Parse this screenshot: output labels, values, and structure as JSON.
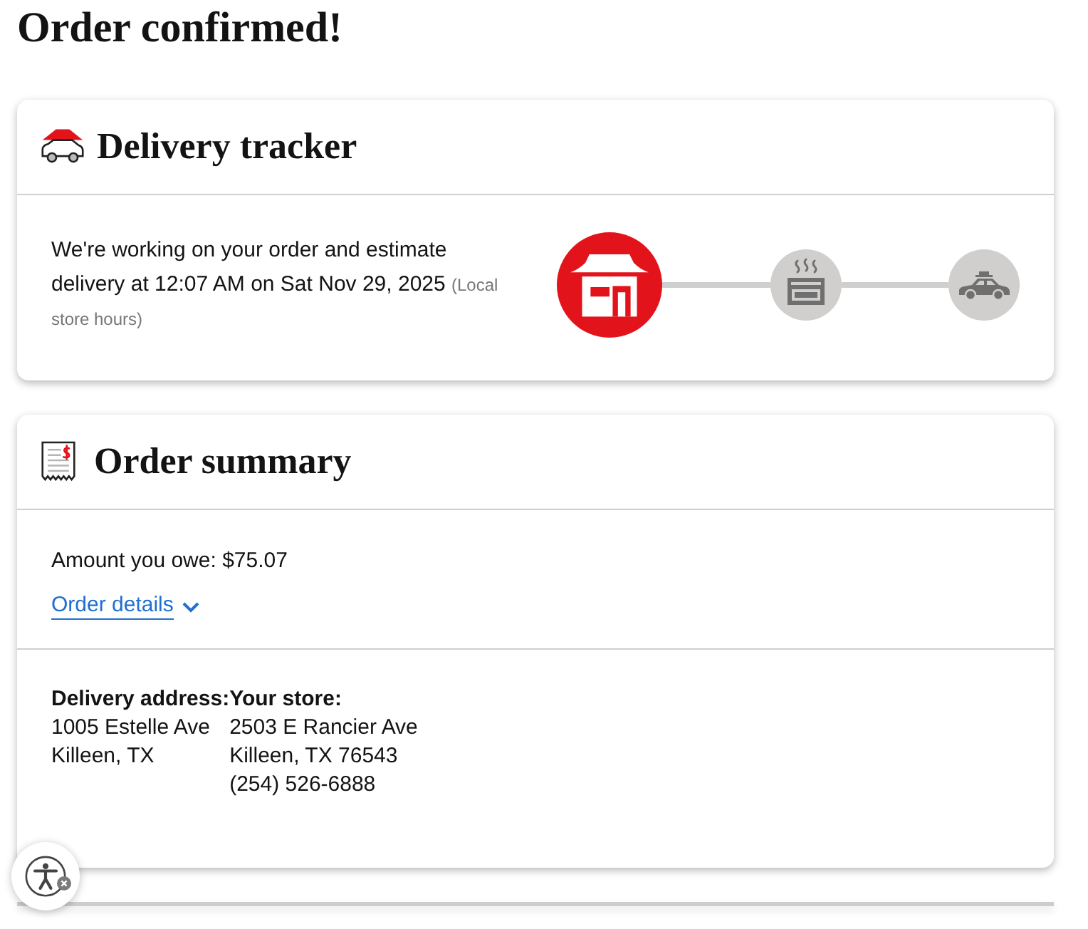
{
  "page": {
    "title": "Order confirmed!"
  },
  "delivery_tracker": {
    "title": "Delivery tracker",
    "message": "We're working on your order and estimate delivery at 12:07 AM on Sat Nov 29, 2025",
    "note": "(Local store hours)",
    "steps": [
      {
        "kind": "store",
        "selected": true
      },
      {
        "kind": "oven",
        "selected": false
      },
      {
        "kind": "car",
        "selected": false
      }
    ]
  },
  "order_summary": {
    "title": "Order summary",
    "amount": "Amount you owe: $75.07",
    "details_link": {
      "label": "Order details",
      "expanded": false
    },
    "delivery_address": {
      "label": "Delivery address:",
      "lines": [
        "1005 Estelle Ave",
        "Killeen, TX"
      ]
    },
    "store": {
      "label": "Your store:",
      "lines": [
        "2503 E Rancier Ave",
        "Killeen, TX 76543",
        "(254) 526-6888"
      ]
    }
  }
}
